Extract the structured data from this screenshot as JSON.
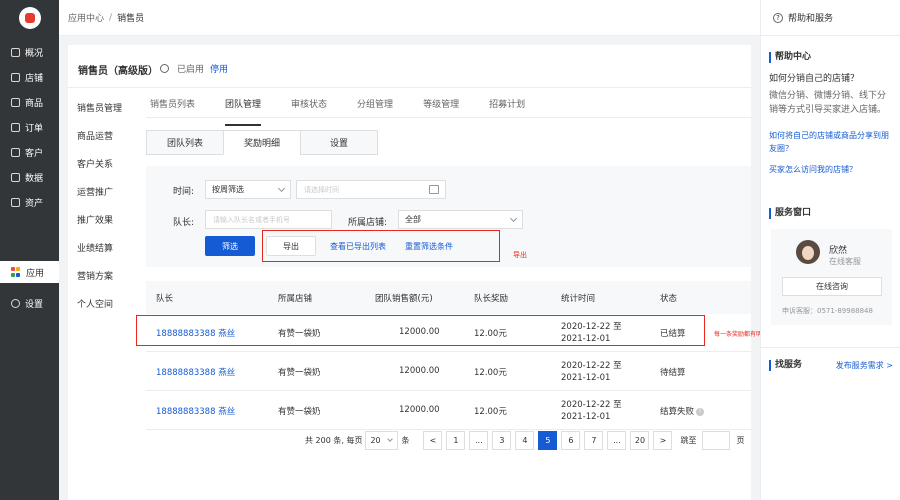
{
  "nav": {
    "items": [
      {
        "label": "概况",
        "icon": "overview-icon"
      },
      {
        "label": "店铺",
        "icon": "store-icon"
      },
      {
        "label": "商品",
        "icon": "goods-icon"
      },
      {
        "label": "订单",
        "icon": "order-icon"
      },
      {
        "label": "客户",
        "icon": "customer-icon"
      },
      {
        "label": "数据",
        "icon": "data-icon"
      },
      {
        "label": "资产",
        "icon": "asset-icon"
      }
    ],
    "apps_label": "应用",
    "settings_label": "设置"
  },
  "breadcrumb": {
    "root": "应用中心",
    "sep": "/",
    "current": "销售员"
  },
  "page": {
    "title": "销售员（高级版）",
    "status": "已启用",
    "stop_link": "停用"
  },
  "subnav": [
    "销售员管理",
    "商品运营",
    "客户关系",
    "运营推广",
    "推广效果",
    "业绩结算",
    "营销方案",
    "个人空间"
  ],
  "tabs": [
    "销售员列表",
    "团队管理",
    "审核状态",
    "分组管理",
    "等级管理",
    "招募计划"
  ],
  "content_tabs": [
    "团队列表",
    "奖励明细",
    "设置"
  ],
  "filter": {
    "time_label": "时间:",
    "time_select": "按周筛选",
    "time_placeholder": "请选择时间",
    "leader_label": "队长:",
    "leader_placeholder": "请输入队长名或者手机号",
    "store_label": "所属店铺:",
    "store_select": "全部",
    "filter_button": "筛选",
    "export_button": "导出",
    "view_exports_link": "查看已导出列表",
    "reset_link": "重置筛选条件",
    "export_note": "导出"
  },
  "table": {
    "headers": [
      "队长",
      "所属店铺",
      "团队销售额(元)",
      "队长奖励",
      "统计时间",
      "状态"
    ],
    "rows": [
      {
        "leader": "18888883388 燕丝",
        "store": "有赞一袋奶",
        "sales": "12000.00",
        "reward": "12.00元",
        "time1": "2020-12-22 至",
        "time2": "2021-12-01",
        "status": "已结算",
        "warn": false
      },
      {
        "leader": "18888883388 燕丝",
        "store": "有赞一袋奶",
        "sales": "12000.00",
        "reward": "12.00元",
        "time1": "2020-12-22 至",
        "time2": "2021-12-01",
        "status": "待结算",
        "warn": false
      },
      {
        "leader": "18888883388 燕丝",
        "store": "有赞一袋奶",
        "sales": "12000.00",
        "reward": "12.00元",
        "time1": "2020-12-22 至",
        "time2": "2021-12-01",
        "status": "结算失败",
        "warn": true
      }
    ],
    "row_note": "每一条奖励都有明细"
  },
  "pager": {
    "total": "共 200 条, 每页",
    "page_size": "20",
    "unit": "条",
    "pages": [
      "1",
      "...",
      "3",
      "4",
      "5",
      "6",
      "7",
      "...",
      "20"
    ],
    "active": "5",
    "jump_label": "跳至",
    "page_unit": "页",
    "prev": "<",
    "next": ">"
  },
  "help": {
    "title": "帮助和服务",
    "center_title": "帮助中心",
    "question": "如何分销自己的店铺？",
    "answer": "微信分销、微博分销、线下分销等方式引导买家进入店铺。",
    "link1": "如何将自己的店铺或商品分享到朋友圈？",
    "link2": "买家怎么访问我的店铺？",
    "service_title": "服务窗口",
    "agent_name": "欣然",
    "agent_status": "在线客服",
    "consult_button": "在线咨询",
    "phone": "申诉客服：0571-89988848",
    "find_service": "找服务",
    "post_request": "发布服务需求 >"
  },
  "colors": {
    "primary": "#155bd4",
    "sidebar": "#333639",
    "annotation": "#e8281f"
  }
}
